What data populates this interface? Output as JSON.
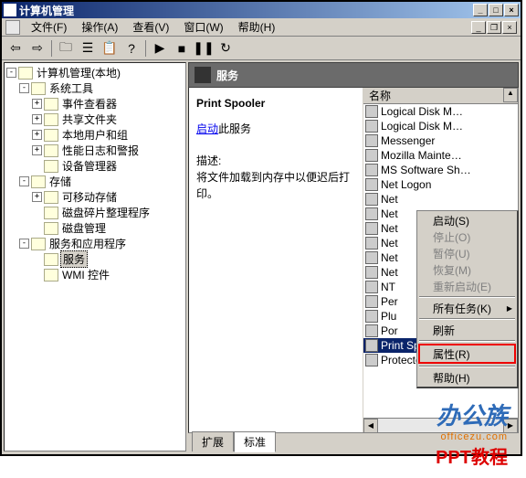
{
  "window": {
    "title": "计算机管理"
  },
  "menu": {
    "file": "文件(F)",
    "action": "操作(A)",
    "view": "查看(V)",
    "window": "窗口(W)",
    "help": "帮助(H)"
  },
  "tree": [
    {
      "d": 0,
      "t": "-",
      "label": "计算机管理(本地)",
      "icon": "computer"
    },
    {
      "d": 1,
      "t": "-",
      "label": "系统工具",
      "icon": "tools"
    },
    {
      "d": 2,
      "t": "+",
      "label": "事件查看器",
      "icon": "event"
    },
    {
      "d": 2,
      "t": "+",
      "label": "共享文件夹",
      "icon": "share"
    },
    {
      "d": 2,
      "t": "+",
      "label": "本地用户和组",
      "icon": "users"
    },
    {
      "d": 2,
      "t": "+",
      "label": "性能日志和警报",
      "icon": "perf"
    },
    {
      "d": 2,
      "t": "",
      "label": "设备管理器",
      "icon": "device"
    },
    {
      "d": 1,
      "t": "-",
      "label": "存储",
      "icon": "storage"
    },
    {
      "d": 2,
      "t": "+",
      "label": "可移动存储",
      "icon": "removable"
    },
    {
      "d": 2,
      "t": "",
      "label": "磁盘碎片整理程序",
      "icon": "defrag"
    },
    {
      "d": 2,
      "t": "",
      "label": "磁盘管理",
      "icon": "diskmgmt"
    },
    {
      "d": 1,
      "t": "-",
      "label": "服务和应用程序",
      "icon": "apps"
    },
    {
      "d": 2,
      "t": "",
      "label": "服务",
      "icon": "services",
      "selected": true
    },
    {
      "d": 2,
      "t": "",
      "label": "WMI 控件",
      "icon": "wmi"
    }
  ],
  "svc_header": "服务",
  "detail": {
    "name": "Print Spooler",
    "start_link": "启动",
    "start_suffix": "此服务",
    "desc_label": "描述:",
    "desc": "将文件加载到内存中以便迟后打印。"
  },
  "list": {
    "header": "名称",
    "services": [
      "Logical Disk M…",
      "Logical Disk M…",
      "Messenger",
      "Mozilla Mainte…",
      "MS Software Sh…",
      "Net Logon",
      "Net",
      "Net",
      "Net",
      "Net",
      "Net",
      "Net",
      "NT",
      "Per",
      "Plu",
      "Por",
      "Print Spooler",
      "Protected Storage"
    ],
    "selected_index": 16
  },
  "context_menu": [
    {
      "label": "启动(S)",
      "enabled": true
    },
    {
      "label": "停止(O)",
      "enabled": false
    },
    {
      "label": "暂停(U)",
      "enabled": false
    },
    {
      "label": "恢复(M)",
      "enabled": false
    },
    {
      "label": "重新启动(E)",
      "enabled": false
    },
    {
      "sep": true
    },
    {
      "label": "所有任务(K)",
      "enabled": true,
      "sub": true
    },
    {
      "sep": true
    },
    {
      "label": "刷新",
      "enabled": true
    },
    {
      "sep": true
    },
    {
      "label": "属性(R)",
      "enabled": true,
      "highlighted": true
    },
    {
      "sep": true
    },
    {
      "label": "帮助(H)",
      "enabled": true
    }
  ],
  "tabs": {
    "extended": "扩展",
    "standard": "标准"
  },
  "watermark": {
    "brand": "办公族",
    "url": "officezu.com",
    "sub": "PPT教程"
  }
}
